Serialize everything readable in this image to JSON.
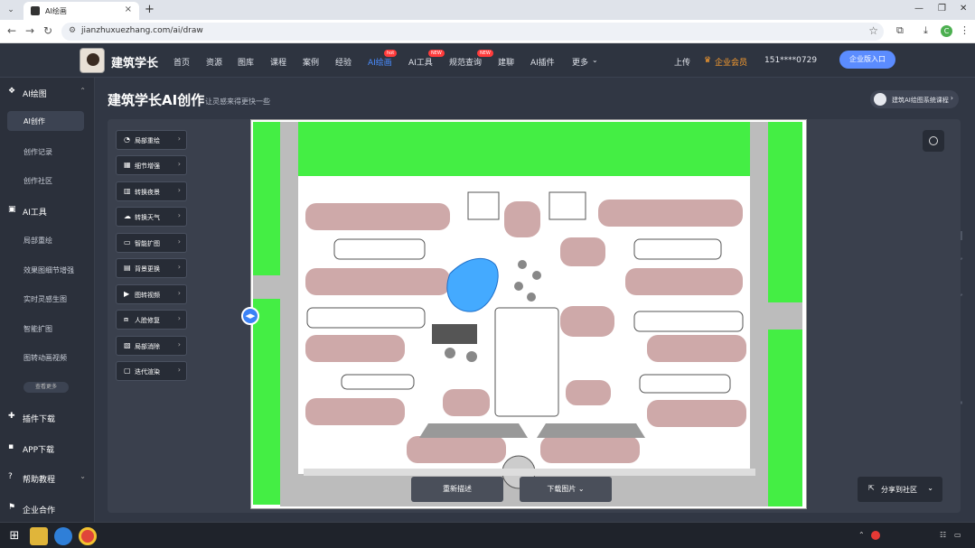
{
  "browser": {
    "tab_title": "AI绘画",
    "url": "jianzhuxuezhang.com/ai/draw",
    "profile_initial": "C"
  },
  "header": {
    "brand": "建筑学长",
    "nav": [
      "首页",
      "资源",
      "图库",
      "课程",
      "案例",
      "经验",
      "AI绘画",
      "AI工具",
      "规范查询",
      "建聊",
      "AI插件",
      "更多"
    ],
    "nav_active": "AI绘画",
    "badges": {
      "ai_draw": "hot",
      "ai_tool": "NEW",
      "spec": "NEW"
    },
    "upload": "上传",
    "vip": "企业会员",
    "phone": "151****0729",
    "enterprise_btn": "企业版入口"
  },
  "sidebar": {
    "sections": [
      {
        "label": "AI绘图",
        "icon": "palette-icon"
      },
      {
        "label": "AI工具",
        "icon": "toolbox-icon"
      },
      {
        "label": "插件下载",
        "icon": "puzzle-icon"
      },
      {
        "label": "APP下载",
        "icon": "phone-icon"
      },
      {
        "label": "帮助教程",
        "icon": "help-icon"
      },
      {
        "label": "企业合作",
        "icon": "handshake-icon"
      }
    ],
    "draw_items": [
      "AI创作",
      "创作记录",
      "创作社区"
    ],
    "tool_items": [
      "局部重绘",
      "效果图细节增强",
      "实时灵感生图",
      "智能扩图",
      "图转动画视频"
    ],
    "more": "查看更多"
  },
  "main": {
    "title": "建筑学长AI创作",
    "subtitle": "让灵感来得更快一些",
    "course_btn": "建筑AI绘图系统课程",
    "tools": [
      "局部重绘",
      "细节增强",
      "转换夜景",
      "转换天气",
      "智能扩图",
      "背景更换",
      "图转视频",
      "人脸修复",
      "局部消除",
      "迭代渲染"
    ],
    "regenerate": "重新描述",
    "download": "下载图片",
    "share": "分享到社区"
  },
  "colors": {
    "accent": "#4a8dff",
    "green": "#44ee44",
    "pink": "#c9a0a0",
    "blue": "#44aaff"
  }
}
